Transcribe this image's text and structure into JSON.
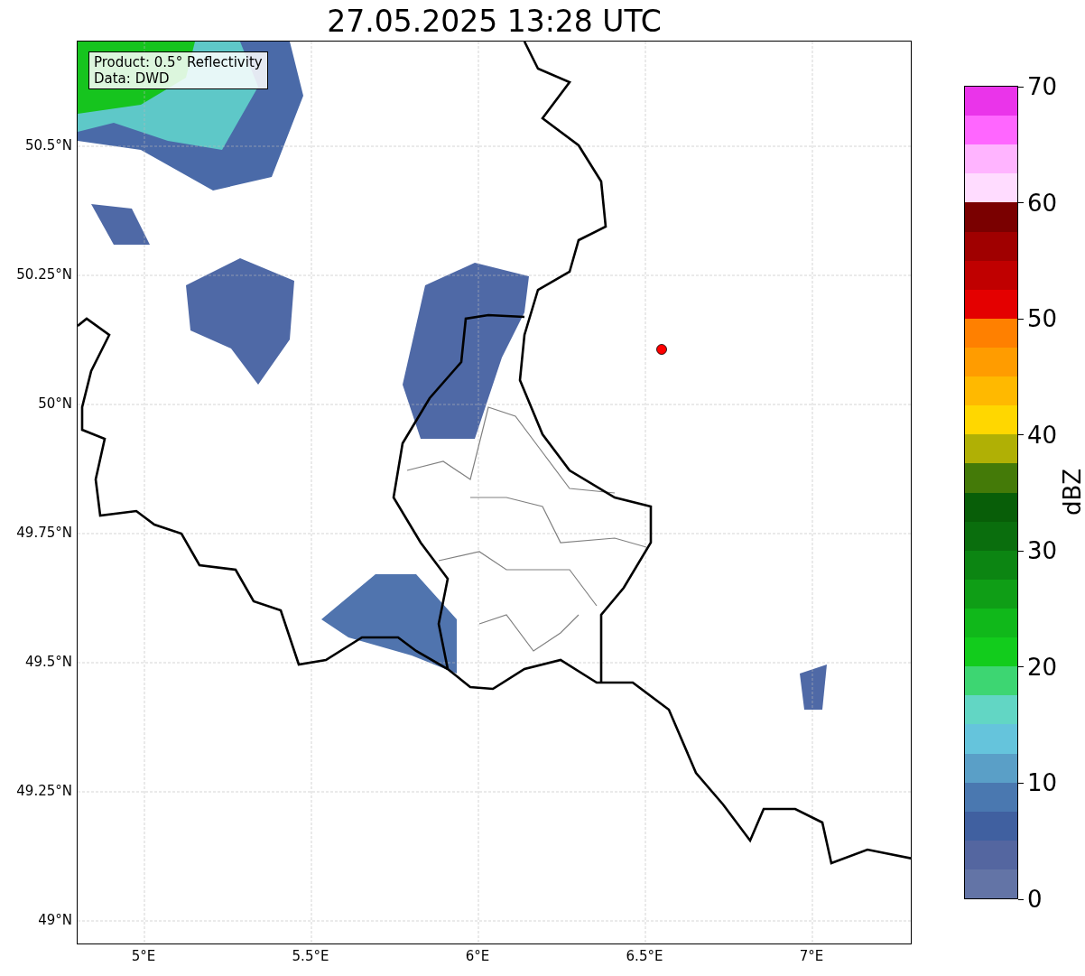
{
  "title": "27.05.2025 13:28 UTC",
  "map": {
    "info_box": [
      "Product: 0.5° Reflectivity",
      "Data: DWD"
    ],
    "y_ticks": [
      "50.5°N",
      "50.25°N",
      "50°N",
      "49.75°N",
      "49.5°N",
      "49.25°N",
      "49°N"
    ],
    "x_ticks": [
      "5°E",
      "5.5°E",
      "6°E",
      "6.5°E",
      "7°E"
    ]
  },
  "colorbar": {
    "label": "dBZ",
    "ticks": [
      "70",
      "60",
      "50",
      "40",
      "30",
      "20",
      "10",
      "0"
    ],
    "bands": [
      {
        "color": "#ea34ea"
      },
      {
        "color": "#ff66ff"
      },
      {
        "color": "#ffb4ff"
      },
      {
        "color": "#ffdcff"
      },
      {
        "color": "#7a0000"
      },
      {
        "color": "#a00000"
      },
      {
        "color": "#c00000"
      },
      {
        "color": "#e40000"
      },
      {
        "color": "#ff8000"
      },
      {
        "color": "#ff9c00"
      },
      {
        "color": "#ffb900"
      },
      {
        "color": "#ffd700"
      },
      {
        "color": "#b0b005"
      },
      {
        "color": "#447a08"
      },
      {
        "color": "#085e08"
      },
      {
        "color": "#0a6e0d"
      },
      {
        "color": "#0c8512"
      },
      {
        "color": "#0f9e16"
      },
      {
        "color": "#10b81a"
      },
      {
        "color": "#12cc1c"
      },
      {
        "color": "#3dd672"
      },
      {
        "color": "#62d6c4"
      },
      {
        "color": "#65c4dc"
      },
      {
        "color": "#5a9fc7"
      },
      {
        "color": "#4a78b0"
      },
      {
        "color": "#4060a0"
      },
      {
        "color": "#5466a0"
      },
      {
        "color": "#6374a6"
      }
    ]
  }
}
